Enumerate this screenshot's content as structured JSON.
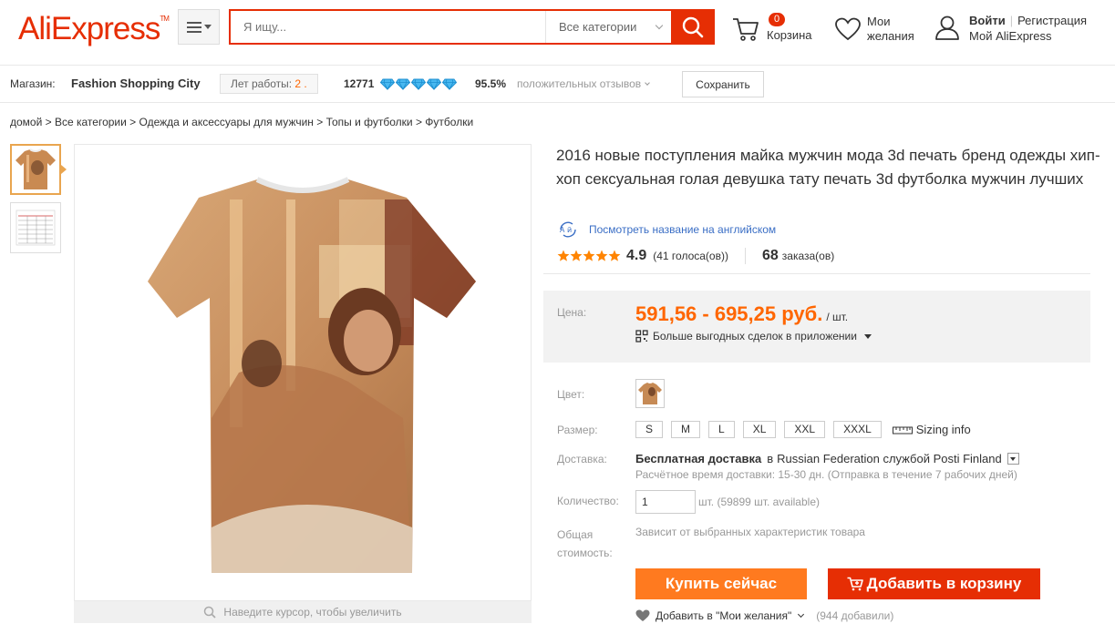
{
  "header": {
    "logo": "AliExpress",
    "logo_tm": "TM",
    "search_placeholder": "Я ищу...",
    "search_category": "Все категории",
    "cart_count": "0",
    "cart_label": "Корзина",
    "wishlist_label_1": "Мои",
    "wishlist_label_2": "желания",
    "login": "Войти",
    "register": "Регистрация",
    "my_account": "Мой AliExpress"
  },
  "store": {
    "label": "Магазин:",
    "name": "Fashion Shopping City",
    "years_label": "Лет работы:",
    "years_value": "2 .",
    "score": "12771",
    "positive_pct": "95.5%",
    "positive_label": "положительных отзывов",
    "save_label": "Сохранить"
  },
  "breadcrumb": "домой > Все категории > Одежда и аксессуары для мужчин > Топы и футболки > Футболки",
  "product": {
    "title": "2016 новые поступления майка мужчин мода 3d печать бренд одежды хип-хоп сексуальная голая девушка тату печать 3d футболка мужчин лучших",
    "english_link": "Посмотреть название на английском",
    "rating": "4.9",
    "votes": "(41 голоса(ов))",
    "orders_count": "68",
    "orders_label": "заказа(ов)",
    "zoom_hint": "Наведите курсор, чтобы увеличить"
  },
  "price": {
    "label": "Цена:",
    "value": "591,56 - 695,25 руб.",
    "unit": "/ шт.",
    "app_deals": "Больше выгодных сделок в приложении"
  },
  "options": {
    "color_label": "Цвет:",
    "size_label": "Размер:",
    "sizes": [
      "S",
      "M",
      "L",
      "XL",
      "XXL",
      "XXXL"
    ],
    "sizing_info": "Sizing info",
    "delivery_label": "Доставка:",
    "delivery_free": "Бесплатная доставка",
    "delivery_in": "в",
    "delivery_dest": "Russian Federation службой Posti Finland",
    "delivery_time": "Расчётное время доставки: 15-30 дн. (Отправка в течение 7 рабочих дней)",
    "qty_label": "Количество:",
    "qty_value": "1",
    "qty_info": "шт. (59899 шт. available)",
    "total_label_1": "Общая",
    "total_label_2": "стоимость:",
    "total_value": "Зависит от выбранных характеристик товара"
  },
  "actions": {
    "buy_now": "Купить сейчас",
    "add_to_cart": "Добавить в корзину",
    "wishlist": "Добавить в \"Мои желания\"",
    "wishlist_count": "(944 добавили)"
  },
  "colors": {
    "brand": "#e62e04",
    "price": "#ff6600",
    "buy": "#ff7a1f",
    "link": "#3a6ec5"
  }
}
